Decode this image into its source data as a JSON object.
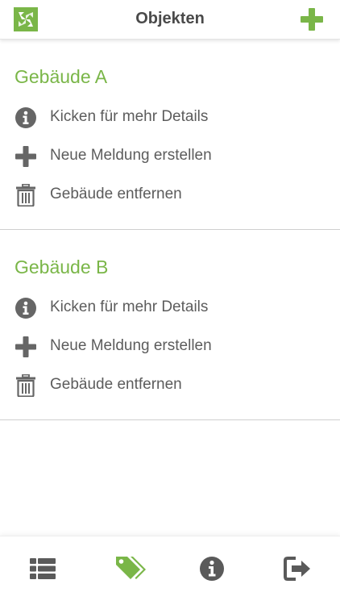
{
  "header": {
    "title": "Objekten",
    "logo_icon": "app-logo-icon",
    "add_icon": "plus-icon"
  },
  "colors": {
    "accent": "#7ab648",
    "text": "#5c5c5c",
    "icon": "#666666",
    "title": "#4a4a4a"
  },
  "buildings": [
    {
      "name": "Gebäude A",
      "actions": [
        {
          "label": "Kicken für mehr Details",
          "icon": "info-icon"
        },
        {
          "label": "Neue Meldung erstellen",
          "icon": "plus-icon"
        },
        {
          "label": "Gebäude entfernen",
          "icon": "trash-icon"
        }
      ]
    },
    {
      "name": "Gebäude B",
      "actions": [
        {
          "label": "Kicken für mehr Details",
          "icon": "info-icon"
        },
        {
          "label": "Neue Meldung erstellen",
          "icon": "plus-icon"
        },
        {
          "label": "Gebäude entfernen",
          "icon": "trash-icon"
        }
      ]
    }
  ],
  "bottom_nav": [
    {
      "icon": "list-icon",
      "active": false
    },
    {
      "icon": "tags-icon",
      "active": true
    },
    {
      "icon": "info-icon",
      "active": false
    },
    {
      "icon": "logout-icon",
      "active": false
    }
  ]
}
